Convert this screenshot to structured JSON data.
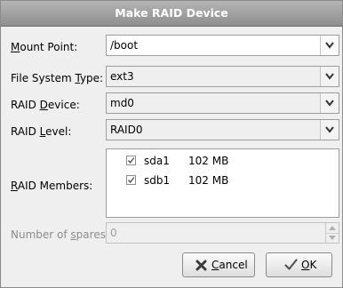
{
  "dialog": {
    "title": "Make RAID Device"
  },
  "mount_point": {
    "label_pre": "",
    "label_accel": "M",
    "label_post": "ount Point:",
    "value": "/boot"
  },
  "filesystem_type": {
    "label_pre": "File System ",
    "label_accel": "T",
    "label_post": "ype:",
    "value": "ext3"
  },
  "raid_device": {
    "label_pre": "RAID ",
    "label_accel": "D",
    "label_post": "evice:",
    "value": "md0"
  },
  "raid_level": {
    "label_pre": "RAID ",
    "label_accel": "L",
    "label_post": "evel:",
    "value": "RAID0"
  },
  "raid_members": {
    "label_pre": "",
    "label_accel": "R",
    "label_post": "AID Members:",
    "items": [
      {
        "device": "sda1",
        "size": "102 MB",
        "checked": true
      },
      {
        "device": "sdb1",
        "size": "102 MB",
        "checked": true
      }
    ]
  },
  "spares": {
    "label_pre": "Number of ",
    "label_accel": "s",
    "label_post": "pares:",
    "value": "0"
  },
  "buttons": {
    "cancel": {
      "label_accel": "C",
      "label_post": "ancel",
      "icon": "cancel-x-icon"
    },
    "ok": {
      "label_accel": "O",
      "label_post": "K",
      "icon": "ok-check-icon"
    }
  }
}
